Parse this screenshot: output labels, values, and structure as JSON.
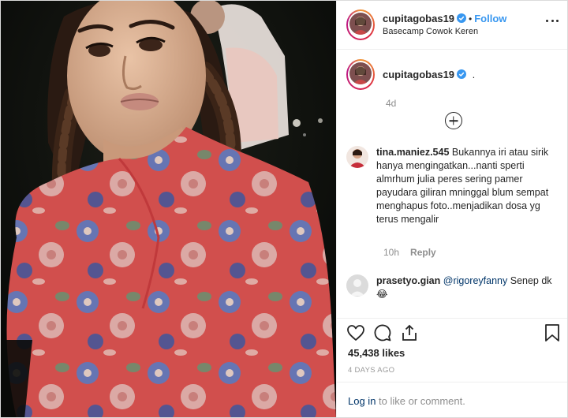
{
  "post": {
    "author": "cupitagobas19",
    "separator": "•",
    "follow_label": "Follow",
    "location": "Basecamp Cowok Keren",
    "caption_text": ".",
    "caption_time": "4d"
  },
  "comments": [
    {
      "username": "tina.maniez.545",
      "text": "Bukannya iri atau sirik hanya mengingatkan...nanti sperti almrhum julia peres sering pamer payudara giliran mninggal blum sempat menghapus foto..menjadikan dosa yg terus mengalir",
      "time": "10h",
      "reply_label": "Reply"
    },
    {
      "username": "prasetyo.gian",
      "mention": "@rigoreyfanny",
      "text": "Senep dk 😂"
    }
  ],
  "likes": "45,438 likes",
  "time_ago": "4 DAYS AGO",
  "login": {
    "link": "Log in",
    "suffix": " to like or comment."
  },
  "icons": {
    "verified": "verified-badge-icon",
    "more": "more-options-icon",
    "load_more": "plus-circle-icon",
    "like": "heart-icon",
    "comment": "comment-icon",
    "share": "share-icon",
    "save": "bookmark-icon"
  },
  "colors": {
    "accent": "#3897f0",
    "link": "#003569",
    "muted": "#8e8e8e",
    "dress": "#e85a5a"
  }
}
